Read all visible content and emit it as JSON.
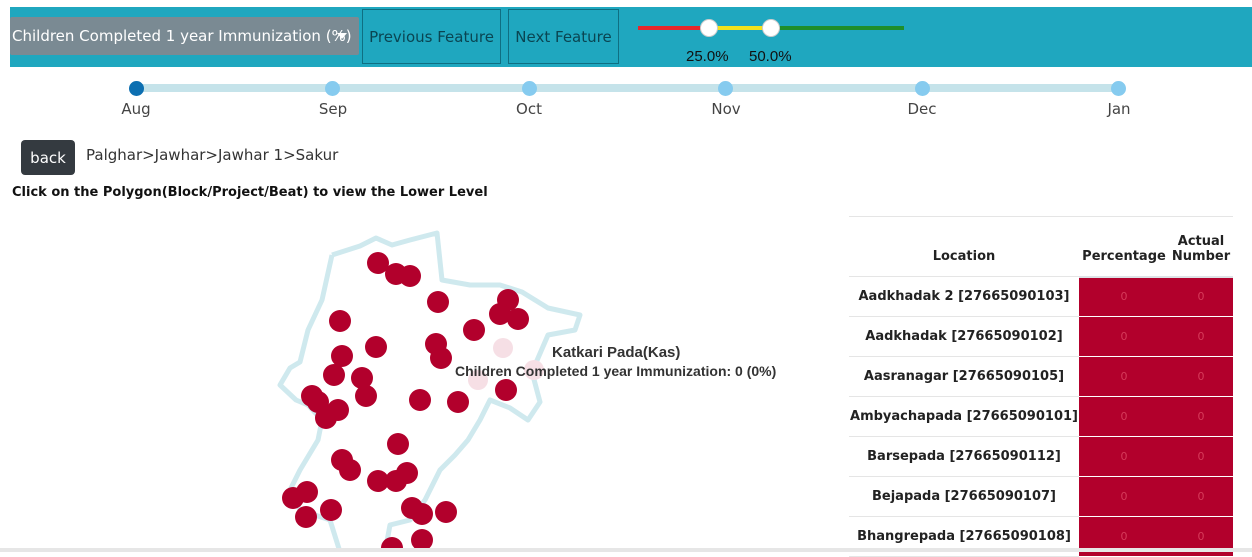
{
  "header": {
    "feature_select": "Children Completed 1 year Immunization (%)",
    "prev_label": "Previous Feature",
    "next_label": "Next Feature",
    "range": {
      "low_label": "25.0%",
      "high_label": "50.0%",
      "low": 0.25,
      "high": 0.5,
      "colors": [
        "#e8262b",
        "#f1e21c",
        "#1e8e2b"
      ]
    }
  },
  "timeline": {
    "months": [
      "Aug",
      "Sep",
      "Oct",
      "Nov",
      "Dec",
      "Jan"
    ],
    "active": "Aug"
  },
  "nav": {
    "back_label": "back",
    "breadcrumb": "Palghar>Jawhar>Jawhar 1>Sakur"
  },
  "instruction": "Click on the Polygon(Block/Project/Beat) to view the Lower Level",
  "map": {
    "tooltip_title": "Katkari Pada(Kas)",
    "tooltip_body": "Children Completed 1 year Immunization: 0 (0%)",
    "marker_color": "#b2002c",
    "boundary_color": "#cfe9ee"
  },
  "table": {
    "headers": {
      "location": "Location",
      "percentage": "Percentage",
      "actual_line1": "Actual",
      "actual_line2": "Number"
    },
    "rows": [
      {
        "location": "Aadkhadak 2 [27665090103]",
        "percentage": "0",
        "actual": "0"
      },
      {
        "location": "Aadkhadak [27665090102]",
        "percentage": "0",
        "actual": "0"
      },
      {
        "location": "Aasranagar [27665090105]",
        "percentage": "0",
        "actual": "0"
      },
      {
        "location": "Ambyachapada [27665090101]",
        "percentage": "0",
        "actual": "0"
      },
      {
        "location": "Barsepada [27665090112]",
        "percentage": "0",
        "actual": "0"
      },
      {
        "location": "Bejapada [27665090107]",
        "percentage": "0",
        "actual": "0"
      },
      {
        "location": "Bhangrepada [27665090108]",
        "percentage": "0",
        "actual": "0"
      }
    ]
  }
}
